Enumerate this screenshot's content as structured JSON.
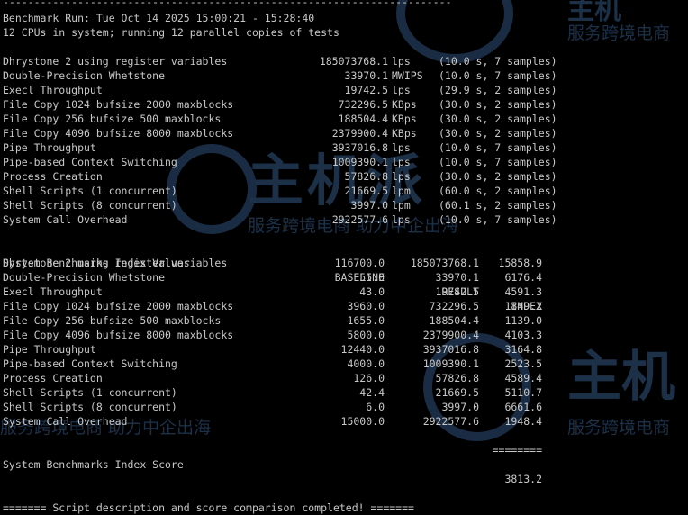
{
  "terminal": {
    "top_rule": "------------------------------------------------------------------------",
    "run_line": "Benchmark Run: Tue Oct 14 2025 15:00:21 - 15:28:40",
    "cpu_line": "12 CPUs in system; running 12 parallel copies of tests",
    "tests": [
      {
        "name": "Dhrystone 2 using register variables",
        "value": "185073768.1",
        "unit": "lps",
        "info": "(10.0 s, 7 samples)"
      },
      {
        "name": "Double-Precision Whetstone",
        "value": "33970.1",
        "unit": "MWIPS",
        "info": "(10.0 s, 7 samples)"
      },
      {
        "name": "Execl Throughput",
        "value": "19742.5",
        "unit": "lps",
        "info": "(29.9 s, 2 samples)"
      },
      {
        "name": "File Copy 1024 bufsize 2000 maxblocks",
        "value": "732296.5",
        "unit": "KBps",
        "info": "(30.0 s, 2 samples)"
      },
      {
        "name": "File Copy 256 bufsize 500 maxblocks",
        "value": "188504.4",
        "unit": "KBps",
        "info": "(30.0 s, 2 samples)"
      },
      {
        "name": "File Copy 4096 bufsize 8000 maxblocks",
        "value": "2379900.4",
        "unit": "KBps",
        "info": "(30.0 s, 2 samples)"
      },
      {
        "name": "Pipe Throughput",
        "value": "3937016.8",
        "unit": "lps",
        "info": "(10.0 s, 7 samples)"
      },
      {
        "name": "Pipe-based Context Switching",
        "value": "1009390.1",
        "unit": "lps",
        "info": "(10.0 s, 7 samples)"
      },
      {
        "name": "Process Creation",
        "value": "57826.8",
        "unit": "lps",
        "info": "(30.0 s, 2 samples)"
      },
      {
        "name": "Shell Scripts (1 concurrent)",
        "value": "21669.5",
        "unit": "lpm",
        "info": "(60.0 s, 2 samples)"
      },
      {
        "name": "Shell Scripts (8 concurrent)",
        "value": "3997.0",
        "unit": "lpm",
        "info": "(60.1 s, 2 samples)"
      },
      {
        "name": "System Call Overhead",
        "value": "2922577.6",
        "unit": "lps",
        "info": "(10.0 s, 7 samples)"
      }
    ],
    "index_header": {
      "title": "System Benchmarks Index Values",
      "baseline": "BASELINE",
      "result": "RESULT",
      "index": "INDEX"
    },
    "index_rows": [
      {
        "name": "Dhrystone 2 using register variables",
        "baseline": "116700.0",
        "result": "185073768.1",
        "index": "15858.9"
      },
      {
        "name": "Double-Precision Whetstone",
        "baseline": "55.0",
        "result": "33970.1",
        "index": "6176.4"
      },
      {
        "name": "Execl Throughput",
        "baseline": "43.0",
        "result": "19742.5",
        "index": "4591.3"
      },
      {
        "name": "File Copy 1024 bufsize 2000 maxblocks",
        "baseline": "3960.0",
        "result": "732296.5",
        "index": "1849.2"
      },
      {
        "name": "File Copy 256 bufsize 500 maxblocks",
        "baseline": "1655.0",
        "result": "188504.4",
        "index": "1139.0"
      },
      {
        "name": "File Copy 4096 bufsize 8000 maxblocks",
        "baseline": "5800.0",
        "result": "2379900.4",
        "index": "4103.3"
      },
      {
        "name": "Pipe Throughput",
        "baseline": "12440.0",
        "result": "3937016.8",
        "index": "3164.8"
      },
      {
        "name": "Pipe-based Context Switching",
        "baseline": "4000.0",
        "result": "1009390.1",
        "index": "2523.5"
      },
      {
        "name": "Process Creation",
        "baseline": "126.0",
        "result": "57826.8",
        "index": "4589.4"
      },
      {
        "name": "Shell Scripts (1 concurrent)",
        "baseline": "42.4",
        "result": "21669.5",
        "index": "5110.7"
      },
      {
        "name": "Shell Scripts (8 concurrent)",
        "baseline": "6.0",
        "result": "3997.0",
        "index": "6661.6"
      },
      {
        "name": "System Call Overhead",
        "baseline": "15000.0",
        "result": "2922577.6",
        "index": "1948.4"
      }
    ],
    "score_rule": "========",
    "score_label": "System Benchmarks Index Score",
    "score_value": "3813.2",
    "completion_line": "======= Script description and score comparison completed! ======="
  },
  "watermark": {
    "logo_text": "主机",
    "logo_text_mid": "主机派",
    "slogan_1": "服务跨境电商",
    "slogan_2": "服务跨境电商 助力中企出海",
    "slogan_3": "服务跨境电商 助力中企出海",
    "slogan_4": "服务跨境电商"
  },
  "colors": {
    "background": "#000000",
    "text": "#c8c8c8",
    "watermark": "#1c3048"
  }
}
